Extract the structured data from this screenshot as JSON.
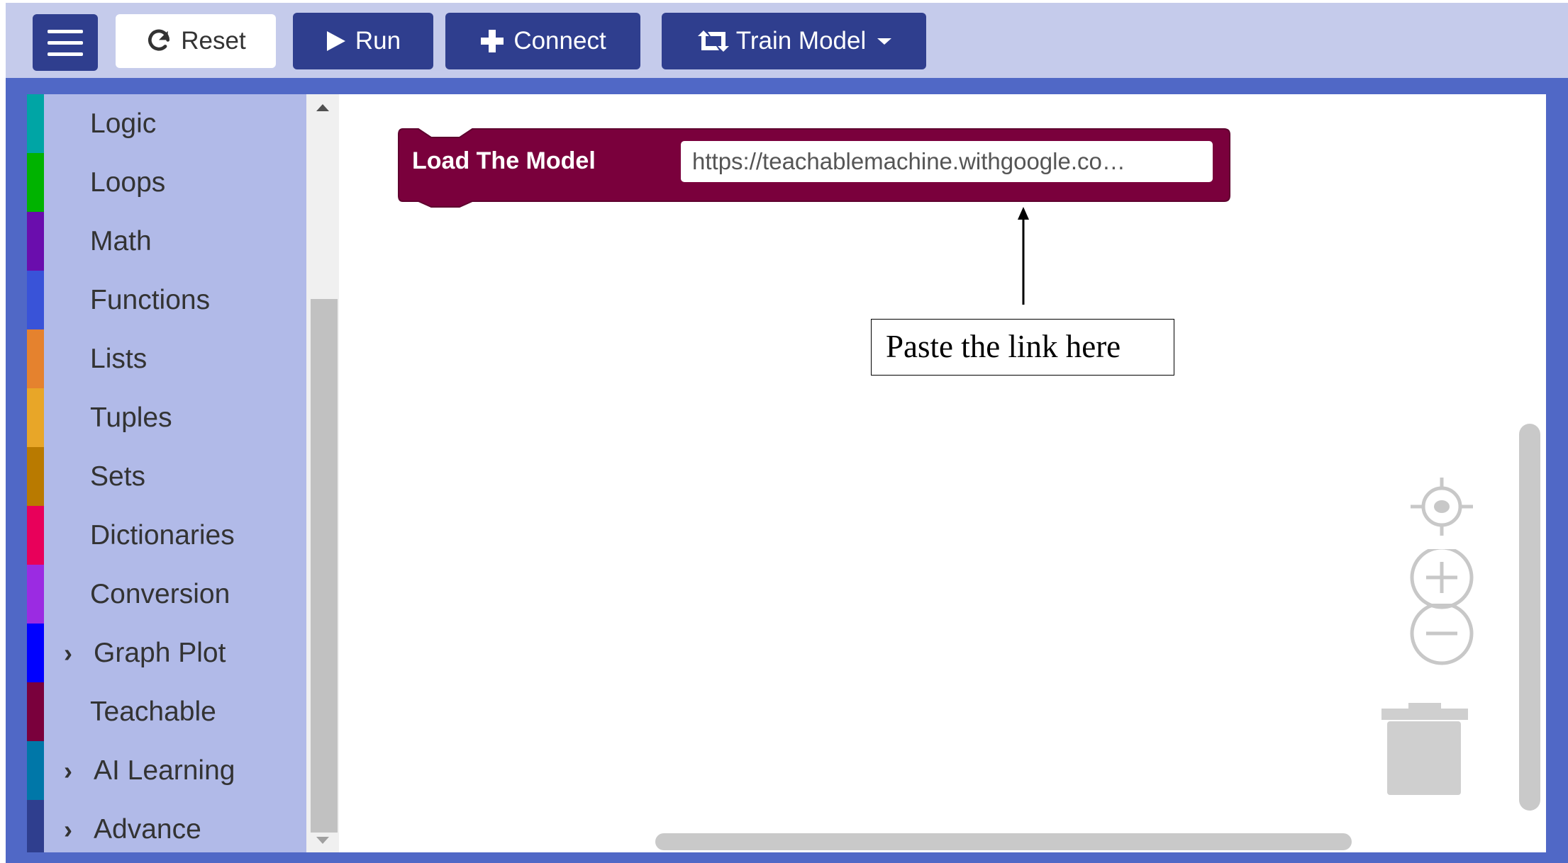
{
  "toolbar": {
    "reset_label": "Reset",
    "run_label": "Run",
    "connect_label": "Connect",
    "train_label": "Train Model"
  },
  "toolbox": {
    "categories": [
      {
        "label": "Logic",
        "color": "#00a5a5",
        "expandable": false
      },
      {
        "label": "Loops",
        "color": "#00b300",
        "expandable": false
      },
      {
        "label": "Math",
        "color": "#6a0dad",
        "expandable": false
      },
      {
        "label": "Functions",
        "color": "#3953d8",
        "expandable": false
      },
      {
        "label": "Lists",
        "color": "#e5822e",
        "expandable": false
      },
      {
        "label": "Tuples",
        "color": "#e8a628",
        "expandable": false
      },
      {
        "label": "Sets",
        "color": "#b97a00",
        "expandable": false
      },
      {
        "label": "Dictionaries",
        "color": "#e8005a",
        "expandable": false
      },
      {
        "label": "Conversion",
        "color": "#9b2be2",
        "expandable": false
      },
      {
        "label": "Graph Plot",
        "color": "#0000ff",
        "expandable": true
      },
      {
        "label": "Teachable",
        "color": "#7a003c",
        "expandable": false
      },
      {
        "label": "AI Learning",
        "color": "#0077a8",
        "expandable": true
      },
      {
        "label": "Advance",
        "color": "#2f3e8e",
        "expandable": true
      }
    ]
  },
  "block": {
    "label": "Load The Model",
    "url_value": "https://teachablemachine.withgoogle.co…",
    "color": "#7a003c"
  },
  "callout": {
    "text": "Paste the link here"
  },
  "colors": {
    "toolbar_bg": "#c5cbeb",
    "button_dark": "#2f3e8e",
    "workspace_border": "#5068c6",
    "toolbox_bg": "#b1bae8"
  }
}
